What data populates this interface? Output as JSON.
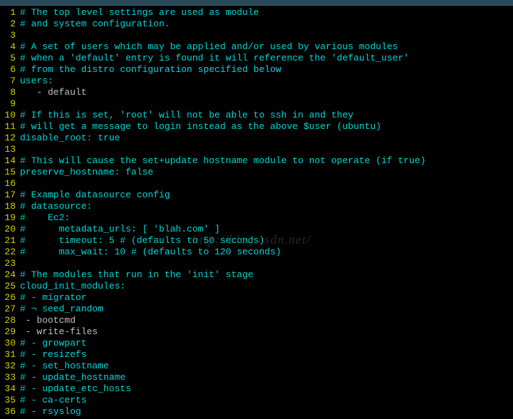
{
  "watermark": "http://blog.csdn.net/",
  "lines": [
    {
      "n": 1,
      "segs": [
        {
          "cls": "c-comment",
          "t": "# The top level settings are used as module"
        }
      ]
    },
    {
      "n": 2,
      "segs": [
        {
          "cls": "c-comment",
          "t": "# and system configuration."
        }
      ]
    },
    {
      "n": 3,
      "segs": []
    },
    {
      "n": 4,
      "segs": [
        {
          "cls": "c-comment",
          "t": "# A set of users which may be applied and/or used by various modules"
        }
      ]
    },
    {
      "n": 5,
      "segs": [
        {
          "cls": "c-comment",
          "t": "# when a 'default' entry is found it will reference the 'default_user'"
        }
      ]
    },
    {
      "n": 6,
      "segs": [
        {
          "cls": "c-comment",
          "t": "# from the distro configuration specified below"
        }
      ]
    },
    {
      "n": 7,
      "segs": [
        {
          "cls": "c-key",
          "t": "users:"
        }
      ]
    },
    {
      "n": 8,
      "segs": [
        {
          "cls": "c-white",
          "t": "   - default"
        }
      ]
    },
    {
      "n": 9,
      "segs": []
    },
    {
      "n": 10,
      "segs": [
        {
          "cls": "c-comment",
          "t": "# If this is set, 'root' will not be able to ssh in and they"
        }
      ]
    },
    {
      "n": 11,
      "segs": [
        {
          "cls": "c-comment",
          "t": "# will get a message to login instead as the above $user (ubuntu)"
        }
      ]
    },
    {
      "n": 12,
      "segs": [
        {
          "cls": "c-key",
          "t": "disable_root: true"
        }
      ]
    },
    {
      "n": 13,
      "segs": []
    },
    {
      "n": 14,
      "segs": [
        {
          "cls": "c-comment",
          "t": "# This will cause the set+update hostname module to not operate (if true)"
        }
      ]
    },
    {
      "n": 15,
      "segs": [
        {
          "cls": "c-key",
          "t": "preserve_hostname: false"
        }
      ]
    },
    {
      "n": 16,
      "segs": []
    },
    {
      "n": 17,
      "segs": [
        {
          "cls": "c-comment",
          "t": "# Example datasource config"
        }
      ]
    },
    {
      "n": 18,
      "segs": [
        {
          "cls": "c-comment",
          "t": "# datasource:"
        }
      ]
    },
    {
      "n": 19,
      "segs": [
        {
          "cls": "c-comment",
          "t": "#    Ec2:"
        }
      ]
    },
    {
      "n": 20,
      "segs": [
        {
          "cls": "c-comment",
          "t": "#      metadata_urls: [ 'blah.com' ]"
        }
      ]
    },
    {
      "n": 21,
      "segs": [
        {
          "cls": "c-comment",
          "t": "#      timeout: 5 # (defaults to 50 seconds)"
        }
      ]
    },
    {
      "n": 22,
      "segs": [
        {
          "cls": "c-comment",
          "t": "#      max_wait: 10 # (defaults to 120 seconds)"
        }
      ]
    },
    {
      "n": 23,
      "segs": []
    },
    {
      "n": 24,
      "segs": [
        {
          "cls": "c-comment",
          "t": "# The modules that run in the 'init' stage"
        }
      ]
    },
    {
      "n": 25,
      "segs": [
        {
          "cls": "c-key",
          "t": "cloud_init_modules:"
        }
      ]
    },
    {
      "n": 26,
      "segs": [
        {
          "cls": "c-comment",
          "t": "# - migrator"
        }
      ]
    },
    {
      "n": 27,
      "segs": [
        {
          "cls": "c-comment",
          "t": "# ¬ seed_random"
        }
      ]
    },
    {
      "n": 28,
      "segs": [
        {
          "cls": "c-white",
          "t": " - bootcmd"
        }
      ]
    },
    {
      "n": 29,
      "segs": [
        {
          "cls": "c-white",
          "t": " - write-files"
        }
      ]
    },
    {
      "n": 30,
      "segs": [
        {
          "cls": "c-comment",
          "t": "# - growpart"
        }
      ]
    },
    {
      "n": 31,
      "segs": [
        {
          "cls": "c-comment",
          "t": "# - resizefs"
        }
      ]
    },
    {
      "n": 32,
      "segs": [
        {
          "cls": "c-comment",
          "t": "# - set_hostname"
        }
      ]
    },
    {
      "n": 33,
      "segs": [
        {
          "cls": "c-comment",
          "t": "# - update_hostname"
        }
      ]
    },
    {
      "n": 34,
      "segs": [
        {
          "cls": "c-comment",
          "t": "# - update_etc_hosts"
        }
      ]
    },
    {
      "n": 35,
      "segs": [
        {
          "cls": "c-comment",
          "t": "# - ca-certs"
        }
      ]
    },
    {
      "n": 36,
      "segs": [
        {
          "cls": "c-comment",
          "t": "# - rsyslog"
        }
      ]
    }
  ]
}
